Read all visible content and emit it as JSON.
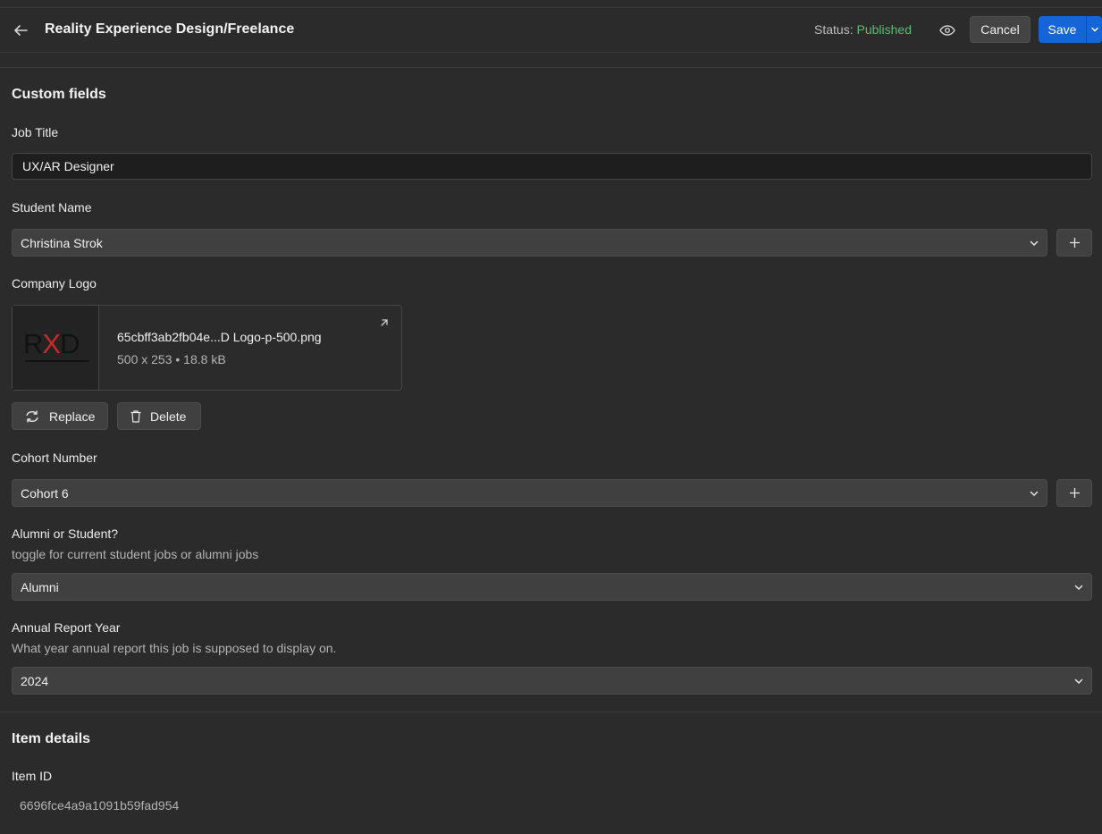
{
  "header": {
    "title": "Reality Experience Design/Freelance",
    "status_label": "Status:",
    "status_value": "Published",
    "cancel_label": "Cancel",
    "save_label": "Save",
    "icons": [
      "arrow-left-icon",
      "eye-icon",
      "chevron-down-icon"
    ]
  },
  "custom_fields": {
    "section_title": "Custom fields",
    "job_title": {
      "label": "Job Title",
      "value": "UX/AR Designer"
    },
    "student_name": {
      "label": "Student Name",
      "value": "Christina Strok"
    },
    "company_logo": {
      "label": "Company Logo",
      "file_name": "65cbff3ab2fb04e...D Logo-p-500.png",
      "file_meta": "500 x 253 • 18.8 kB",
      "replace_label": "Replace",
      "delete_label": "Delete"
    },
    "cohort_number": {
      "label": "Cohort Number",
      "value": "Cohort 6"
    },
    "alumni_or_student": {
      "label": "Alumni or Student?",
      "help": "toggle for current student jobs or alumni jobs",
      "value": "Alumni"
    },
    "annual_report_year": {
      "label": "Annual Report Year",
      "help": "What year annual report this job is supposed to display on.",
      "value": "2024"
    }
  },
  "item_details": {
    "section_title": "Item details",
    "item_id_label": "Item ID",
    "item_id_value": "6696fce4a9a1091b59fad954"
  },
  "colors": {
    "background": "#2b2b2b",
    "status_published": "#5bbd72",
    "primary_button": "#1565d8"
  }
}
